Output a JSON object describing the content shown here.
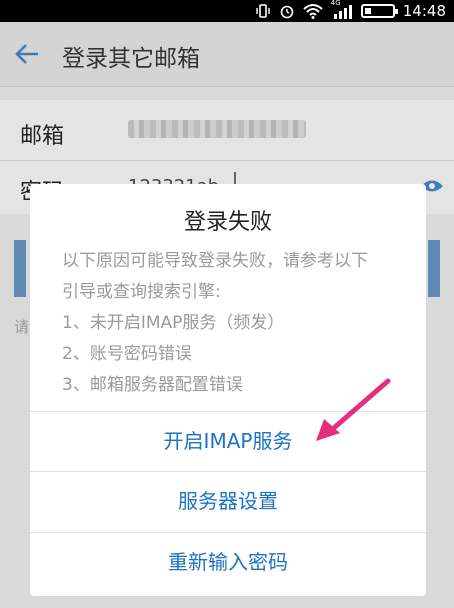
{
  "status_bar": {
    "network": "4G",
    "time": "14:48"
  },
  "app_bar": {
    "title": "登录其它邮箱"
  },
  "form": {
    "email_label": "邮箱",
    "password_label": "密码",
    "password_value": "123321ab"
  },
  "background": {
    "hint_fragment": "请"
  },
  "dialog": {
    "title": "登录失败",
    "message_lines": [
      "以下原因可能导致登录失败，请参考以下",
      "引导或查询搜索引擎:",
      "1、未开启IMAP服务（频发）",
      "2、账号密码错误",
      "3、邮箱服务器配置错误"
    ],
    "buttons": [
      "开启IMAP服务",
      "服务器设置",
      "重新输入密码"
    ]
  },
  "colors": {
    "accent_blue": "#1d72c5",
    "annotation_pink": "#e4307c"
  }
}
